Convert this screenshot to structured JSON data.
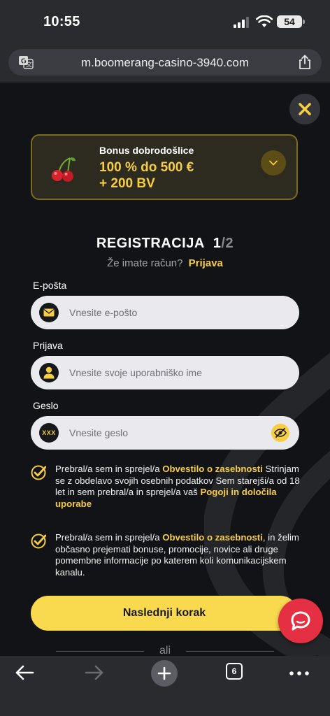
{
  "status_bar": {
    "time": "10:55",
    "battery": "54"
  },
  "browser": {
    "url": "m.boomerang-casino-3940.com",
    "tab_count": "6"
  },
  "bonus": {
    "title": "Bonus dobrodošlice",
    "amount_line1": "100 % do 500 €",
    "amount_line2": "+ 200 BV"
  },
  "registration": {
    "title": "REGISTRACIJA",
    "step_current": "1",
    "step_separator": "/",
    "step_total": "2",
    "have_account": "Že imate račun?",
    "login_link": "Prijava"
  },
  "form": {
    "email": {
      "label": "E-pošta",
      "placeholder": "Vnesite e-pošto"
    },
    "username": {
      "label": "Prijava",
      "placeholder": "Vnesite svoje uporabniško ime"
    },
    "password": {
      "label": "Geslo",
      "placeholder": "Vnesite geslo",
      "icon_text": "XXX"
    }
  },
  "consents": [
    {
      "checked": true,
      "prefix": "Prebral/a sem in sprejel/a ",
      "link1": "Obvestilo o zasebnosti",
      "middle": " Strinjam se z obdelavo svojih osebnih podatkov  Sem starejši/a od 18 let in sem prebral/a in sprejel/a vaš ",
      "link2": "Pogoji in določila uporabe",
      "suffix": ""
    },
    {
      "checked": true,
      "prefix": "Prebral/a sem in sprejel/a ",
      "link1": "Obvestilo o zasebnosti",
      "middle": ", in želim občasno prejemati bonuse, promocije, novice ali druge pomembne informacije po katerem koli komunikacijskem kanalu.",
      "link2": "",
      "suffix": ""
    }
  ],
  "actions": {
    "next_step": "Naslednji korak",
    "or": "ali"
  },
  "colors": {
    "accent": "#f7cd41",
    "button": "#f9d94e",
    "chat": "#e52f42",
    "background": "#121316"
  },
  "icons": [
    "translate-icon",
    "share-icon",
    "close-icon",
    "cherry-icon",
    "chevron-down-icon",
    "mail-icon",
    "user-icon",
    "eye-off-icon",
    "check-icon",
    "chat-icon",
    "back-arrow-icon",
    "forward-arrow-icon",
    "plus-icon",
    "tabs-icon",
    "more-icon"
  ]
}
